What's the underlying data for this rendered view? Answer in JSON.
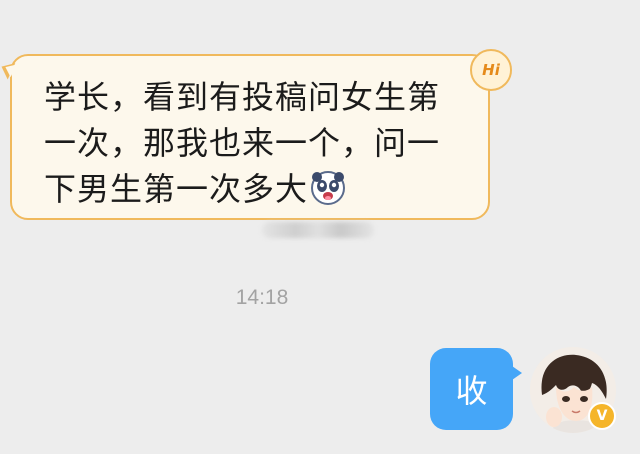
{
  "incoming": {
    "text": "学长，看到有投稿问女生第一次，那我也来一个，问一下男生第一次多大",
    "badge_label": "Hi",
    "emoji_icon": "panda-face-emoji"
  },
  "timestamp": "14:18",
  "outgoing": {
    "text": "收"
  },
  "colors": {
    "background": "#ededed",
    "incoming_bubble": "#fdf8ec",
    "incoming_border": "#f0b95c",
    "outgoing_bubble": "#45a6f8",
    "timestamp_text": "#a3a3a3"
  }
}
